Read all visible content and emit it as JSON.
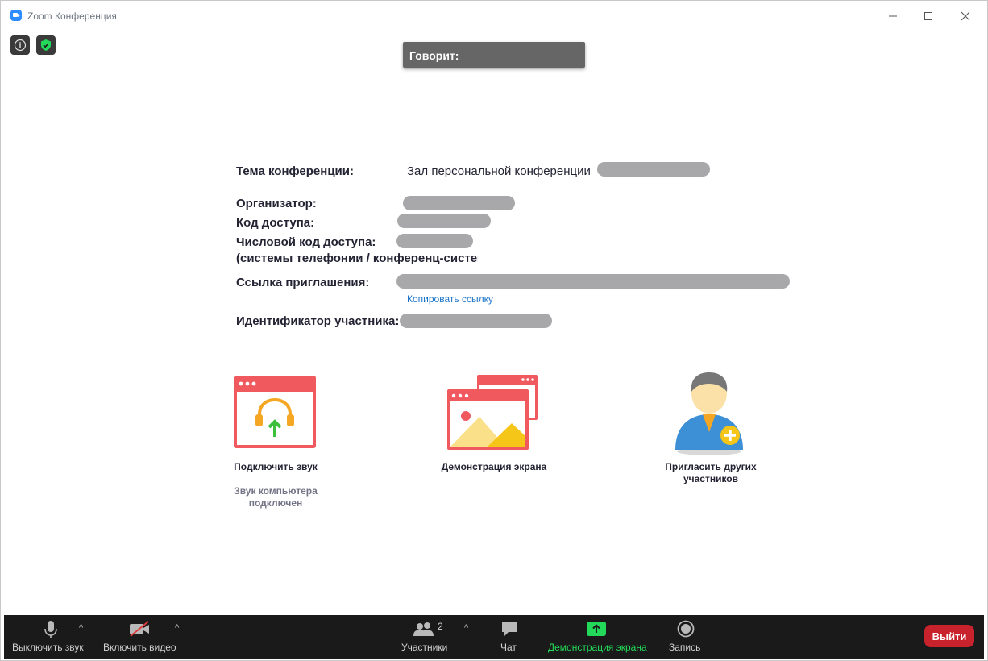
{
  "window": {
    "title": "Zoom Конференция",
    "minimize_glyph": "—",
    "maximize_glyph": "☐",
    "close_glyph": "✕"
  },
  "top_controls": {
    "info_icon": "info-icon",
    "security_icon": "shield-check-icon"
  },
  "speaker": {
    "label": "Говорит:"
  },
  "meeting_info": {
    "topic_label": "Тема конференции:",
    "topic_value": "Зал персональной конференции",
    "host_label": "Организатор:",
    "passcode_label": "Код доступа:",
    "numeric_passcode_label": "Числовой код доступа:",
    "numeric_passcode_sublabel": "(системы телефонии / конференц-систем",
    "invite_link_label": "Ссылка приглашения:",
    "copy_link": "Копировать ссылку",
    "participant_id_label": "Идентификатор участника:"
  },
  "actions": {
    "join_audio": {
      "label": "Подключить звук",
      "status": "Звук компьютера подключен"
    },
    "share_screen": {
      "label": "Демонстрация экрана"
    },
    "invite": {
      "label": "Пригласить других участников"
    }
  },
  "toolbar": {
    "mute_label": "Выключить звук",
    "video_label": "Включить видео",
    "participants_label": "Участники",
    "participants_count": "2",
    "chat_label": "Чат",
    "share_label": "Демонстрация экрана",
    "record_label": "Запись",
    "leave_label": "Выйти",
    "caret": "^"
  },
  "colors": {
    "accent_blue": "#2d8cff",
    "share_green": "#23d959",
    "leave_red": "#c8232c",
    "redaction_gray": "#a8a8ab",
    "tile_red": "#f05a5f",
    "link_blue": "#1a73c9"
  }
}
